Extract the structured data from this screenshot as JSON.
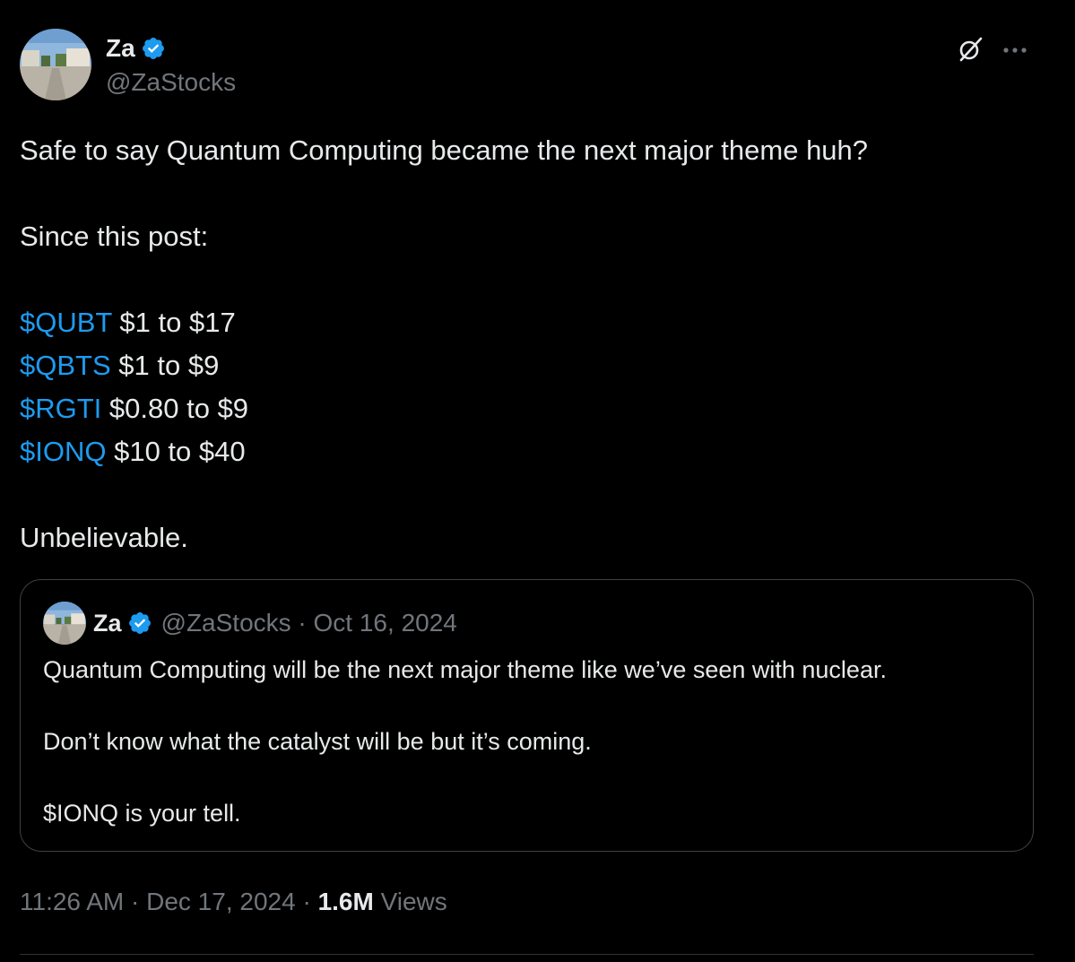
{
  "author": {
    "display_name": "Za",
    "handle": "@ZaStocks",
    "verified_color": "#1d9bf0"
  },
  "post": {
    "lines": {
      "intro": "Safe to say Quantum Computing became the next major theme huh?",
      "since": "Since this post:",
      "tickers": [
        {
          "tag": "$QUBT",
          "text": " $1 to $17"
        },
        {
          "tag": "$QBTS",
          "text": " $1 to $9"
        },
        {
          "tag": "$RGTI",
          "text": " $0.80 to $9"
        },
        {
          "tag": "$IONQ",
          "text": " $10 to $40"
        }
      ],
      "closing": "Unbelievable."
    }
  },
  "quote": {
    "display_name": "Za",
    "handle_and_date": "@ZaStocks · Oct 16, 2024",
    "lines": {
      "p1": "Quantum Computing will be the next major theme like we’ve seen with nuclear.",
      "p2": "Don’t know what the catalyst will be but it’s coming.",
      "p3": "$IONQ is your tell."
    }
  },
  "meta": {
    "timestamp": "11:26 AM · Dec 17, 2024 · ",
    "views_count": "1.6M",
    "views_label": " Views"
  },
  "icons": {
    "grok": "grok-icon",
    "more": "more-icon",
    "verified": "verified-badge-icon"
  },
  "colors": {
    "background": "#000000",
    "text": "#e7e9ea",
    "muted": "#71767b",
    "link": "#1d9bf0",
    "border": "#3e4144"
  }
}
